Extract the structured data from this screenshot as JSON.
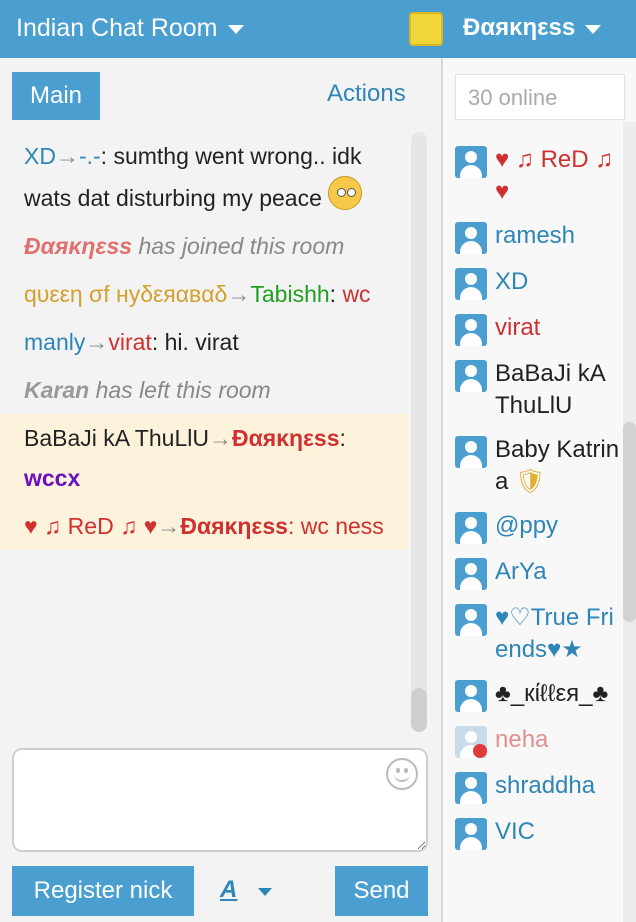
{
  "header": {
    "room_title": "Indian Chat Room",
    "user_name": "Ðαяκηεss"
  },
  "tabs": {
    "main": "Main",
    "actions": "Actions"
  },
  "messages": [
    {
      "type": "chat",
      "from": "XD",
      "from_color": "#2e85b8",
      "to": "-.-",
      "to_color": "#2e85b8",
      "text": ": sumthg went wrong.. idk wats dat disturbing my peace",
      "emoji": "confused-emoji"
    },
    {
      "type": "system",
      "user": "Ðαяκηεss",
      "user_color": "#e07070",
      "text": " has joined this room"
    },
    {
      "type": "chat",
      "from": "qυεεη σf нуδεяαвαδ",
      "from_color": "#d4a030",
      "to": "Tabishh",
      "to_color": "#20a020",
      "text": ": ",
      "text2": "wc",
      "text2_color": "#d03030"
    },
    {
      "type": "chat",
      "from": "manly",
      "from_color": "#2e85b8",
      "to": "virat",
      "to_color": "#d03030",
      "text": ": hi. virat"
    },
    {
      "type": "system",
      "user": "Karan",
      "user_color": "#999",
      "text": " has left this room"
    },
    {
      "type": "chat",
      "highlight": true,
      "from": "BaBaJi kA ThuLlU",
      "from_color": "#222",
      "to": "Ðαяκηεss",
      "to_color": "#d03030",
      "to_bold": true,
      "text": ": ",
      "text2": "wccx",
      "text2_color": "#6a10c0",
      "text2_bold": true
    },
    {
      "type": "chat",
      "highlight": true,
      "from": "♥ ♫ ReD ♫ ♥",
      "from_color": "#d03030",
      "to": "Ðαяκηεss",
      "to_color": "#d03030",
      "to_bold": true,
      "text": ": wc ness",
      "text_color": "#d03030"
    }
  ],
  "arrow": "→",
  "composer": {
    "placeholder": ""
  },
  "buttons": {
    "register": "Register nick",
    "font": "A",
    "send": "Send"
  },
  "online": {
    "label": "30 online"
  },
  "users": [
    {
      "name": "♥ ♫ ReD ♫ ♥",
      "color": "#d03030",
      "status": "active"
    },
    {
      "name": "ramesh",
      "color": "#2e85b8",
      "status": "active"
    },
    {
      "name": "XD",
      "color": "#2e85b8",
      "status": "active"
    },
    {
      "name": "virat",
      "color": "#d03030",
      "status": "active"
    },
    {
      "name": "BaBaJi kA ThuLlU",
      "color": "#222",
      "status": "active"
    },
    {
      "name": "Baby Katrina",
      "color": "#222",
      "status": "active",
      "badge": "shield"
    },
    {
      "name": "@ppy",
      "color": "#2e85b8",
      "status": "active"
    },
    {
      "name": "ArYa",
      "color": "#2e85b8",
      "status": "active"
    },
    {
      "name": "♥♡True Friends♥★",
      "color": "#2e85b8",
      "status": "active"
    },
    {
      "name": "♣_кίℓℓεя_♣",
      "color": "#222",
      "status": "active"
    },
    {
      "name": "neha",
      "color": "#e09090",
      "status": "away"
    },
    {
      "name": "shraddha",
      "color": "#2e85b8",
      "status": "active"
    },
    {
      "name": "VIC",
      "color": "#2e85b8",
      "status": "active"
    }
  ]
}
